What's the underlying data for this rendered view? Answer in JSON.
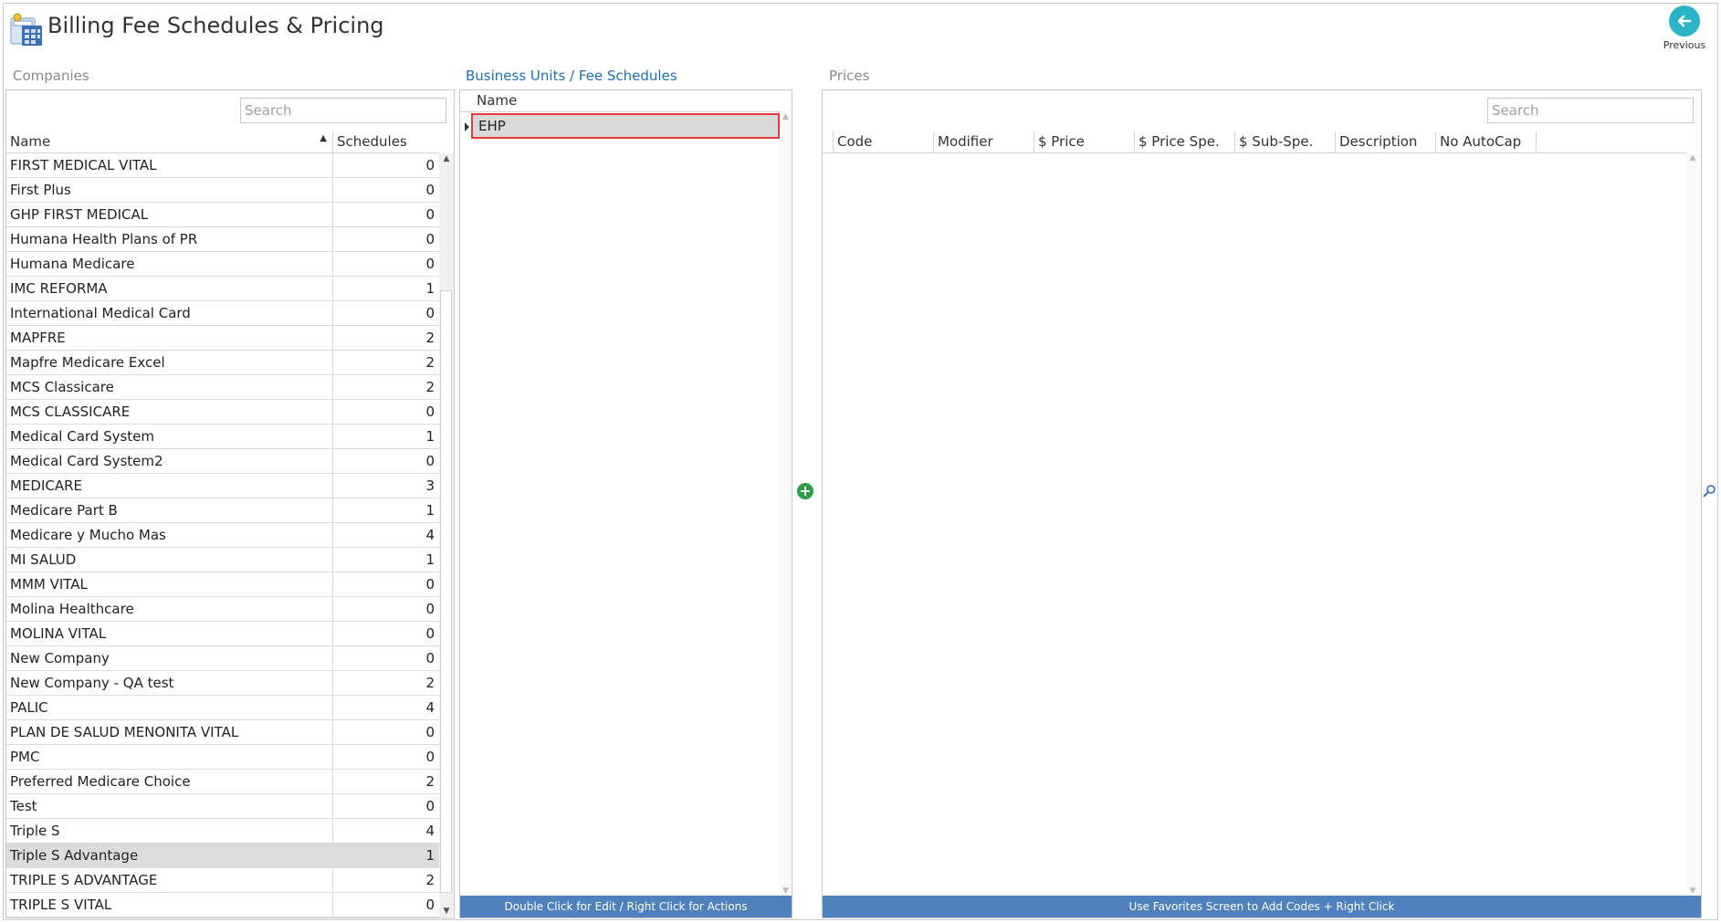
{
  "window": {
    "title": "Billing Fee Schedules & Pricing",
    "previous_label": "Previous"
  },
  "icons": {
    "app": "billing-calculator-icon",
    "previous": "arrow-left-icon",
    "add": "plus-circle-icon",
    "zoom": "magnifier-icon"
  },
  "colors": {
    "accent_blue": "#1f6fbf",
    "footer_blue": "#4f81bd",
    "highlight_red": "#e23b3b",
    "add_green": "#2e9e46",
    "previous_teal": "#2bb3c8"
  },
  "companies": {
    "label": "Companies",
    "search_placeholder": "Search",
    "columns": {
      "name": "Name",
      "schedules": "Schedules"
    },
    "sort": "name-ascending",
    "rows": [
      {
        "name": "FIRST MEDICAL VITAL",
        "schedules": "0"
      },
      {
        "name": "First Plus",
        "schedules": "0"
      },
      {
        "name": "GHP FIRST MEDICAL",
        "schedules": "0"
      },
      {
        "name": "Humana Health Plans of PR",
        "schedules": "0"
      },
      {
        "name": "Humana Medicare",
        "schedules": "0"
      },
      {
        "name": "IMC REFORMA",
        "schedules": "1"
      },
      {
        "name": "International Medical Card",
        "schedules": "0"
      },
      {
        "name": "MAPFRE",
        "schedules": "2"
      },
      {
        "name": "Mapfre Medicare Excel",
        "schedules": "2"
      },
      {
        "name": "MCS Classicare",
        "schedules": "2"
      },
      {
        "name": "MCS CLASSICARE",
        "schedules": "0"
      },
      {
        "name": "Medical Card System",
        "schedules": "1"
      },
      {
        "name": "Medical Card System2",
        "schedules": "0"
      },
      {
        "name": "MEDICARE",
        "schedules": "3"
      },
      {
        "name": "Medicare Part B",
        "schedules": "1"
      },
      {
        "name": "Medicare y Mucho Mas",
        "schedules": "4"
      },
      {
        "name": "MI SALUD",
        "schedules": "1"
      },
      {
        "name": "MMM VITAL",
        "schedules": "0"
      },
      {
        "name": "Molina Healthcare",
        "schedules": "0"
      },
      {
        "name": "MOLINA VITAL",
        "schedules": "0"
      },
      {
        "name": "New Company",
        "schedules": "0"
      },
      {
        "name": "New Company - QA test",
        "schedules": "2"
      },
      {
        "name": "PALIC",
        "schedules": "4"
      },
      {
        "name": "PLAN DE SALUD MENONITA VITAL",
        "schedules": "0"
      },
      {
        "name": "PMC",
        "schedules": "0"
      },
      {
        "name": "Preferred Medicare Choice",
        "schedules": "2"
      },
      {
        "name": "Test",
        "schedules": "0"
      },
      {
        "name": "Triple S",
        "schedules": "4"
      },
      {
        "name": "Triple S Advantage",
        "schedules": "1",
        "selected": true
      },
      {
        "name": "TRIPLE S ADVANTAGE",
        "schedules": "2"
      },
      {
        "name": "TRIPLE S VITAL",
        "schedules": "0"
      }
    ]
  },
  "business_units": {
    "label": "Business Units / Fee Schedules",
    "column": "Name",
    "rows": [
      {
        "name": "EHP",
        "selected": true
      }
    ],
    "footer": "Double Click for Edit / Right Click for Actions"
  },
  "prices": {
    "label": "Prices",
    "search_placeholder": "Search",
    "columns": [
      "Code",
      "Modifier",
      "$ Price",
      "$ Price Spe.",
      "$ Sub-Spe.",
      "Description",
      "No AutoCap"
    ],
    "rows": [],
    "footer": "Use Favorites Screen to Add Codes + Right Click"
  }
}
